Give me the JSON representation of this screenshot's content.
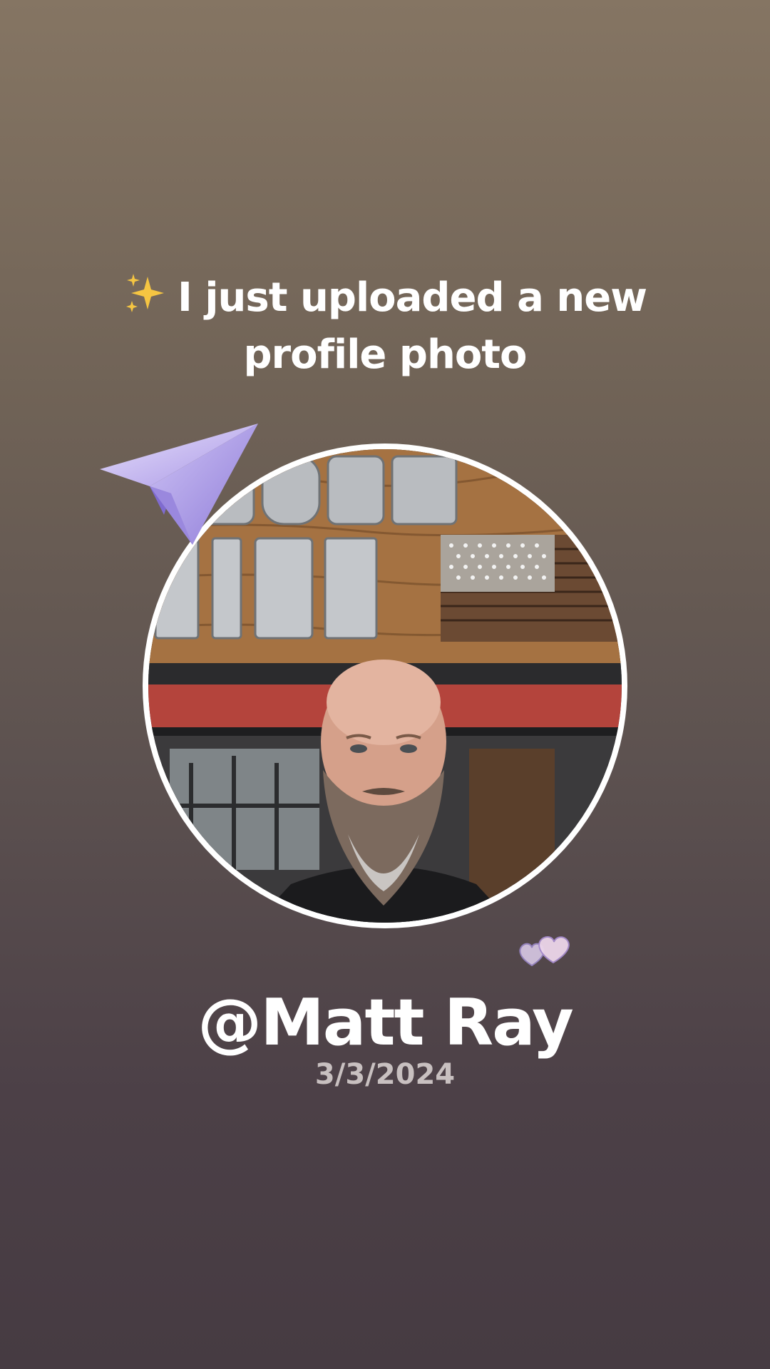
{
  "announcement": {
    "icon": "sparkles-icon",
    "text": "I just uploaded a new profile photo"
  },
  "decorations": {
    "plane_icon": "paper-plane-icon",
    "hearts_icon": "hearts-icon",
    "plane_color": "#b7a9e8"
  },
  "profile": {
    "photo_description_icon": "profile-photo",
    "username": "@Matt Ray",
    "date": "3/3/2024"
  },
  "colors": {
    "background_top": "#857563",
    "background_bottom": "#463b42",
    "text": "#ffffff",
    "date_text": "#c8c0c0"
  }
}
